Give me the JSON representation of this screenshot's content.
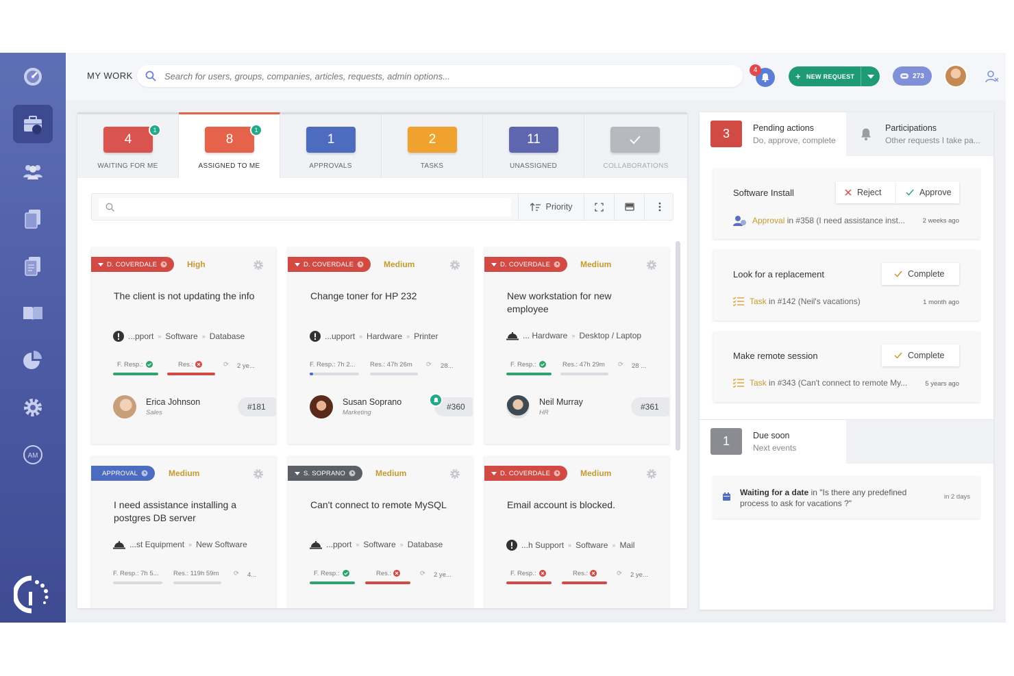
{
  "topbar": {
    "title": "MY WORK",
    "search_placeholder": "Search for users, groups, companies, articles, requests, admin options...",
    "notification_count": "4",
    "new_request_label": "NEW REQUEST",
    "credits": "273"
  },
  "sidebar": {
    "items": [
      "dashboard-icon",
      "briefcase-icon",
      "users-icon",
      "documents-icon",
      "copy-icon",
      "book-icon",
      "pie-chart-icon",
      "gear-icon",
      "am-icon"
    ],
    "active": "briefcase-icon"
  },
  "tabs": [
    {
      "count": "4",
      "label": "WAITING FOR ME",
      "badge": "1",
      "color": "#d9534f"
    },
    {
      "count": "8",
      "label": "ASSIGNED TO ME",
      "badge": "1",
      "color": "#e5634a"
    },
    {
      "count": "1",
      "label": "APPROVALS",
      "badge": "",
      "color": "#4d6cc0"
    },
    {
      "count": "2",
      "label": "TASKS",
      "badge": "",
      "color": "#f0a22e"
    },
    {
      "count": "11",
      "label": "UNASSIGNED",
      "badge": "",
      "color": "#5e66b0"
    },
    {
      "count": "",
      "label": "COLLABORATIONS",
      "badge": "",
      "color": "#b8b9be"
    }
  ],
  "toolbar": {
    "sort_label": "Priority"
  },
  "cards": [
    {
      "tag": "D. COVERDALE",
      "tag_color": "#d24a44",
      "priority": "High",
      "title": "The client is not updating the info",
      "path_icon": "alert",
      "path": [
        "...pport",
        "Software",
        "Database"
      ],
      "f_resp": "F. Resp.:",
      "res": "Res.:",
      "time": "2 ye...",
      "user": "Erica Johnson",
      "dept": "Sales",
      "number": "#181",
      "f_status": "ok",
      "r_status": "bad"
    },
    {
      "tag": "D. COVERDALE",
      "tag_color": "#d24a44",
      "priority": "Medium",
      "title": "Change toner for HP 232",
      "path_icon": "alert",
      "path": [
        "...upport",
        "Hardware",
        "Printer"
      ],
      "f_resp": "F. Resp.: 7h 2...",
      "res": "Res.: 47h 26m",
      "time": "28...",
      "user": "Susan Soprano",
      "dept": "Marketing",
      "number": "#360",
      "f_status": "",
      "r_status": ""
    },
    {
      "tag": "D. COVERDALE",
      "tag_color": "#d24a44",
      "priority": "Medium",
      "title": "New workstation for new employee",
      "path_icon": "bell",
      "path": [
        "... Hardware",
        "Desktop / Laptop"
      ],
      "f_resp": "F. Resp.:",
      "res": "Res.: 47h 29m",
      "time": "28 ...",
      "user": "Neil Murray",
      "dept": "HR",
      "number": "#361",
      "f_status": "ok",
      "r_status": ""
    },
    {
      "tag": "APPROVAL",
      "tag_color": "#4d6cc0",
      "priority": "Medium",
      "title": "I need assistance installing a postgres DB server",
      "path_icon": "bell",
      "path": [
        "...st Equipment",
        "New Software"
      ],
      "f_resp": "F. Resp.: 7h 5...",
      "res": "Res.: 119h 59m",
      "time": "4...",
      "user": "",
      "dept": "",
      "number": "",
      "f_status": "",
      "r_status": ""
    },
    {
      "tag": "S. SOPRANO",
      "tag_color": "#5c6066",
      "priority": "Medium",
      "title": "Can't connect to remote MySQL",
      "path_icon": "bell",
      "path": [
        "...pport",
        "Software",
        "Database"
      ],
      "f_resp": "F. Resp.:",
      "res": "Res.:",
      "time": "2 ye...",
      "user": "",
      "dept": "",
      "number": "",
      "f_status": "ok",
      "r_status": "bad"
    },
    {
      "tag": "D. COVERDALE",
      "tag_color": "#d24a44",
      "priority": "Medium",
      "title": "Email account is blocked.",
      "path_icon": "alert",
      "path": [
        "...h Support",
        "Software",
        "Mail"
      ],
      "f_resp": "F. Resp.:",
      "res": "Res.:",
      "time": "2 ye...",
      "user": "",
      "dept": "",
      "number": "",
      "f_status": "bad",
      "r_status": "bad"
    }
  ],
  "pending": {
    "count": "3",
    "title": "Pending actions",
    "subtitle": "Do, approve, complete",
    "participations_title": "Participations",
    "participations_subtitle": "Other requests I take pa..."
  },
  "actions": [
    {
      "title": "Software Install",
      "buttons": [
        "Reject",
        "Approve"
      ],
      "kind": "Approval",
      "ref": "in #358 (I need assistance inst...",
      "time": "2 weeks ago"
    },
    {
      "title": "Look for a replacement",
      "buttons": [
        "Complete"
      ],
      "kind": "Task",
      "ref": "in #142 (Neil's vacations)",
      "time": "1 month ago"
    },
    {
      "title": "Make remote session",
      "buttons": [
        "Complete"
      ],
      "kind": "Task",
      "ref": "in #343 (Can't connect to remote My...",
      "time": "5 years ago"
    }
  ],
  "due": {
    "count": "1",
    "title": "Due soon",
    "subtitle": "Next events",
    "event_bold": "Waiting for a date",
    "event_text": " in \"Is there any predefined process to ask for vacations ?\"",
    "event_time": "in 2 days"
  }
}
